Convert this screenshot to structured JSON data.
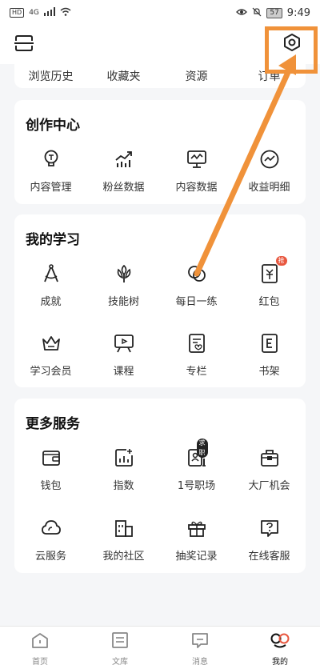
{
  "status_bar": {
    "left_badge": "HD",
    "network": "4G",
    "battery": "57",
    "time": "9:49"
  },
  "top_bar": {
    "scan_icon": "scan-icon",
    "settings_icon": "settings-hex-icon"
  },
  "quick_links": [
    {
      "label": "浏览历史"
    },
    {
      "label": "收藏夹"
    },
    {
      "label": "资源"
    },
    {
      "label": "订单"
    }
  ],
  "creator_center": {
    "title": "创作中心",
    "items": [
      {
        "label": "内容管理",
        "icon": "bulb-icon"
      },
      {
        "label": "粉丝数据",
        "icon": "growth-chart-icon"
      },
      {
        "label": "内容数据",
        "icon": "monitor-chart-icon"
      },
      {
        "label": "收益明细",
        "icon": "earnings-icon"
      }
    ]
  },
  "my_learning": {
    "title": "我的学习",
    "items": [
      {
        "label": "成就",
        "icon": "compass-icon"
      },
      {
        "label": "技能树",
        "icon": "leaf-icon"
      },
      {
        "label": "每日一练",
        "icon": "circles-icon"
      },
      {
        "label": "红包",
        "icon": "red-packet-icon",
        "badge": "抢"
      },
      {
        "label": "学习会员",
        "icon": "crown-icon"
      },
      {
        "label": "课程",
        "icon": "board-icon"
      },
      {
        "label": "专栏",
        "icon": "column-icon"
      },
      {
        "label": "书架",
        "icon": "ebook-icon"
      }
    ]
  },
  "more_services": {
    "title": "更多服务",
    "items": [
      {
        "label": "钱包",
        "icon": "wallet-icon"
      },
      {
        "label": "指数",
        "icon": "index-chart-icon"
      },
      {
        "label": "1号职场",
        "icon": "resume-icon",
        "badge": "求职"
      },
      {
        "label": "大厂机会",
        "icon": "briefcase-icon"
      },
      {
        "label": "云服务",
        "icon": "cloud-icon"
      },
      {
        "label": "我的社区",
        "icon": "community-icon"
      },
      {
        "label": "抽奖记录",
        "icon": "gift-icon"
      },
      {
        "label": "在线客服",
        "icon": "chat-question-icon"
      }
    ]
  },
  "bottom_nav": [
    {
      "label": "首页",
      "icon": "home-icon"
    },
    {
      "label": "文库",
      "icon": "library-icon"
    },
    {
      "label": "消息",
      "icon": "message-icon"
    },
    {
      "label": "我的",
      "icon": "profile-icon"
    }
  ],
  "colors": {
    "accent": "#f0923a",
    "badge_red": "#e8573f",
    "page_bg": "#f5f6f8",
    "card_bg": "#ffffff"
  }
}
